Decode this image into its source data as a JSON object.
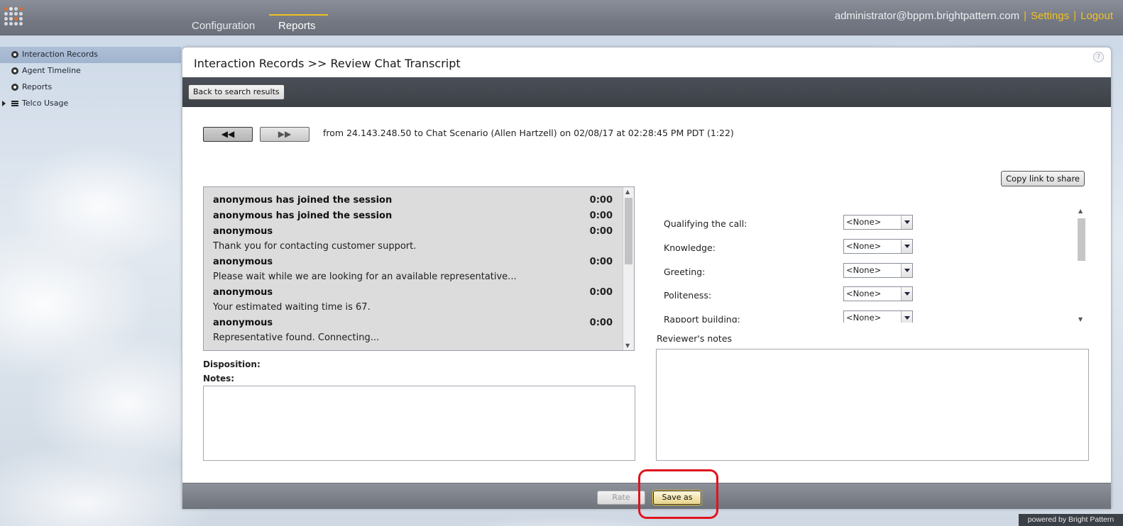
{
  "header": {
    "tabs": [
      "Configuration",
      "Reports"
    ],
    "active_tab": "Reports",
    "user": "administrator@bppm.brightpattern.com",
    "separator": "|",
    "settings": "Settings",
    "logout": "Logout"
  },
  "sidebar": {
    "items": [
      {
        "label": "Interaction Records",
        "active": true
      },
      {
        "label": "Agent Timeline",
        "active": false
      },
      {
        "label": "Reports",
        "active": false
      },
      {
        "label": "Telco Usage",
        "active": false
      }
    ]
  },
  "panel": {
    "breadcrumb": "Interaction Records >> Review Chat Transcript",
    "help": "?",
    "back_button": "Back to search results",
    "prev_button": "◀◀",
    "next_button": "▶▶",
    "interaction_info": "from 24.143.248.50 to Chat Scenario (Allen Hartzell) on 02/08/17 at 02:28:45 PM PDT (1:22)",
    "copy_link": "Copy link to share"
  },
  "transcript": {
    "messages": [
      {
        "author": "anonymous has joined the session",
        "time": "0:00",
        "text": ""
      },
      {
        "author": "anonymous has joined the session",
        "time": "0:00",
        "text": ""
      },
      {
        "author": "anonymous",
        "time": "0:00",
        "text": "Thank you for contacting customer support."
      },
      {
        "author": "anonymous",
        "time": "0:00",
        "text": "Please wait while we are looking for an available representative..."
      },
      {
        "author": "anonymous",
        "time": "0:00",
        "text": "Your estimated waiting time is 67."
      },
      {
        "author": "anonymous",
        "time": "0:00",
        "text": "Representative found. Connecting..."
      }
    ]
  },
  "disposition_label": "Disposition:",
  "notes_label": "Notes:",
  "evaluation": {
    "rows": [
      {
        "label": "Qualifying the call:",
        "value": "<None>"
      },
      {
        "label": "Knowledge:",
        "value": "<None>"
      },
      {
        "label": "Greeting:",
        "value": "<None>"
      },
      {
        "label": "Politeness:",
        "value": "<None>"
      },
      {
        "label": "Rapport building:",
        "value": "<None>"
      }
    ]
  },
  "reviewer_notes_label": "Reviewer's notes",
  "footer": {
    "rate": "Rate",
    "save_as": "Save as"
  },
  "powered_by": "powered by Bright Pattern",
  "colors": {
    "accent": "#f4c21e",
    "highlight": "#e0141e"
  }
}
